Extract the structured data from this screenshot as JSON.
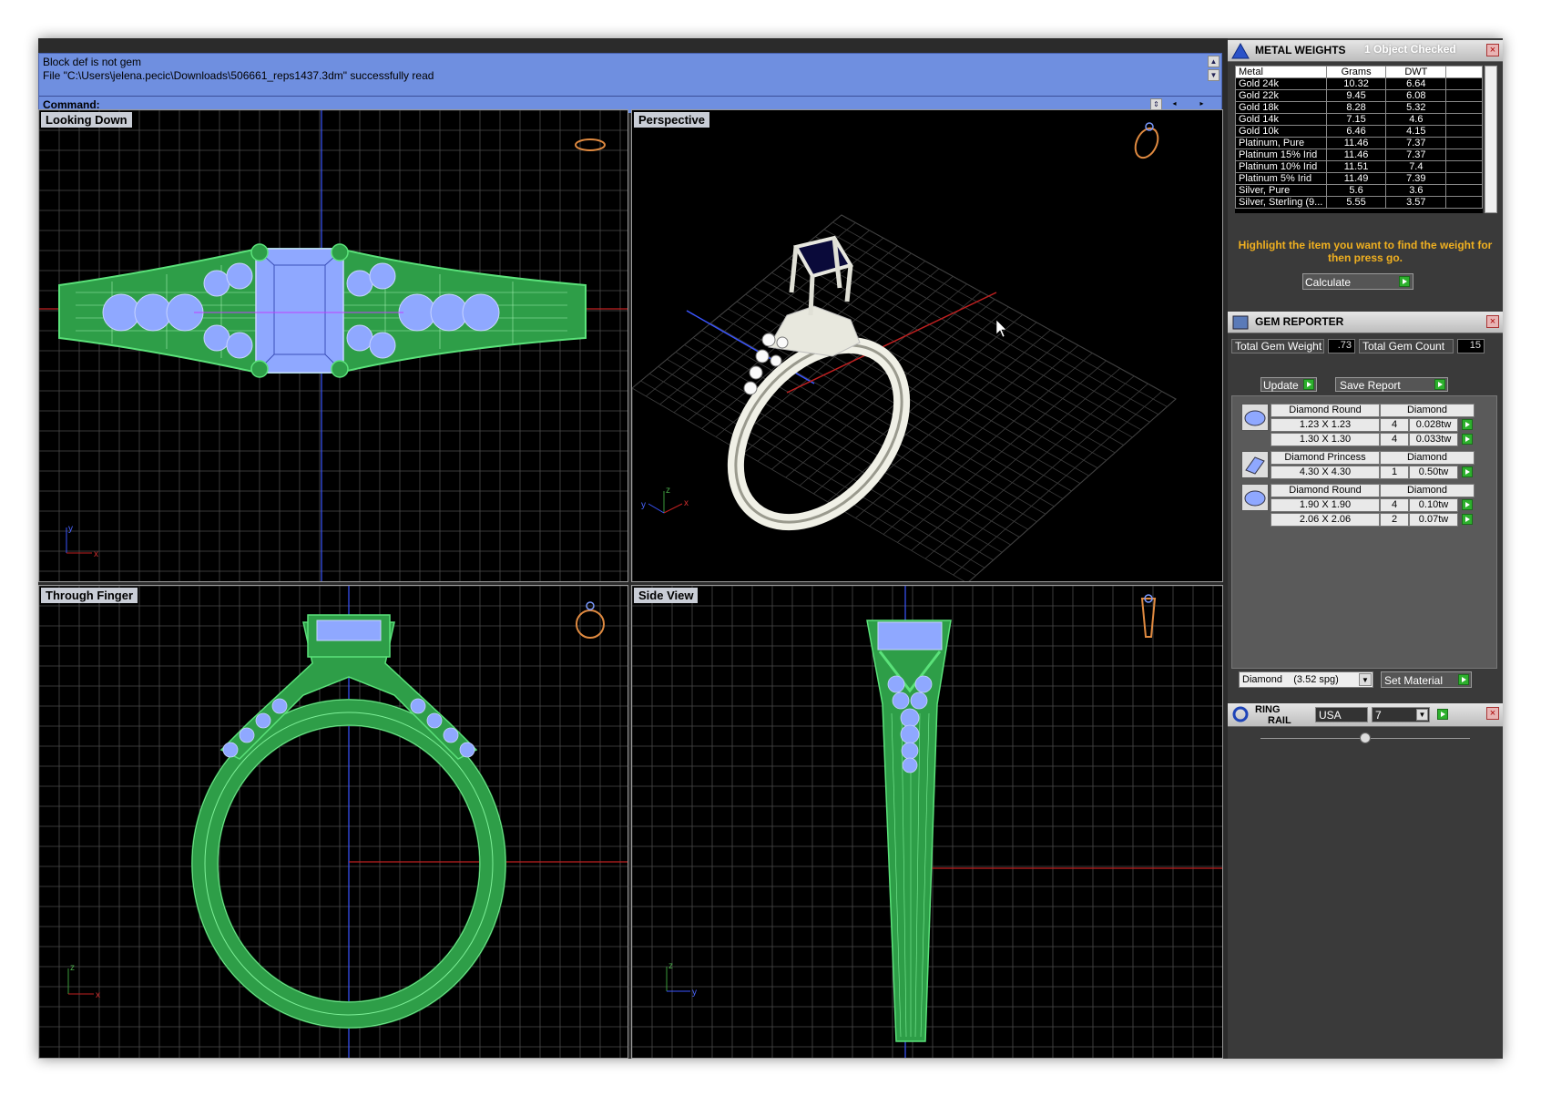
{
  "command": {
    "line1": "Block def is not gem",
    "line2": "File \"C:\\Users\\jelena.pecic\\Downloads\\506661_reps1437.3dm\" successfully read",
    "prompt": "Command:"
  },
  "viewports": {
    "top_left": "Looking Down",
    "top_right": "Perspective",
    "bottom_left": "Through Finger",
    "bottom_right": "Side View"
  },
  "axes": {
    "x": "x",
    "y": "y",
    "z": "z"
  },
  "metal_weights": {
    "title": "METAL WEIGHTS",
    "status": "1 Object Checked",
    "headers": [
      "Metal",
      "Grams",
      "DWT"
    ],
    "rows": [
      [
        "Gold 24k",
        "10.32",
        "6.64"
      ],
      [
        "Gold 22k",
        "9.45",
        "6.08"
      ],
      [
        "Gold 18k",
        "8.28",
        "5.32"
      ],
      [
        "Gold 14k",
        "7.15",
        "4.6"
      ],
      [
        "Gold 10k",
        "6.46",
        "4.15"
      ],
      [
        "Platinum, Pure",
        "11.46",
        "7.37"
      ],
      [
        "Platinum 15% Irid",
        "11.46",
        "7.37"
      ],
      [
        "Platinum 10% Irid",
        "11.51",
        "7.4"
      ],
      [
        "Platinum 5% Irid",
        "11.49",
        "7.39"
      ],
      [
        "Silver, Pure",
        "5.6",
        "3.6"
      ],
      [
        "Silver, Sterling (9...",
        "5.55",
        "3.57"
      ]
    ],
    "hint": "Highlight the item you want to find the weight for then press go.",
    "calculate_label": "Calculate"
  },
  "gem_reporter": {
    "title": "GEM REPORTER",
    "total_weight_label": "Total Gem Weight",
    "total_weight_value": ".73",
    "total_count_label": "Total Gem Count",
    "total_count_value": "15",
    "update_label": "Update",
    "save_label": "Save Report",
    "groups": [
      {
        "name": "Diamond Round",
        "material": "Diamond",
        "icon": "round-gem-icon",
        "rows": [
          [
            "1.23 X 1.23",
            "4",
            "0.028tw"
          ],
          [
            "1.30 X 1.30",
            "4",
            "0.033tw"
          ]
        ]
      },
      {
        "name": "Diamond Princess",
        "material": "Diamond",
        "icon": "princess-gem-icon",
        "rows": [
          [
            "4.30 X 4.30",
            "1",
            "0.50tw"
          ]
        ]
      },
      {
        "name": "Diamond Round",
        "material": "Diamond",
        "icon": "round-gem-icon",
        "rows": [
          [
            "1.90 X 1.90",
            "4",
            "0.10tw"
          ],
          [
            "2.06 X 2.06",
            "2",
            "0.07tw"
          ]
        ]
      }
    ],
    "material_select": "Diamond    (3.52 spg)",
    "set_material_label": "Set Material"
  },
  "ring_rail": {
    "title_line1": "RING",
    "title_line2": "RAIL",
    "country": "USA",
    "size": "7"
  },
  "colors": {
    "command_bg": "#6f8fe0",
    "wire_green": "#3fbf5a",
    "gem_blue": "#8fa8ff",
    "hint_text": "#f0b020",
    "grid": "#4a4a4a"
  }
}
